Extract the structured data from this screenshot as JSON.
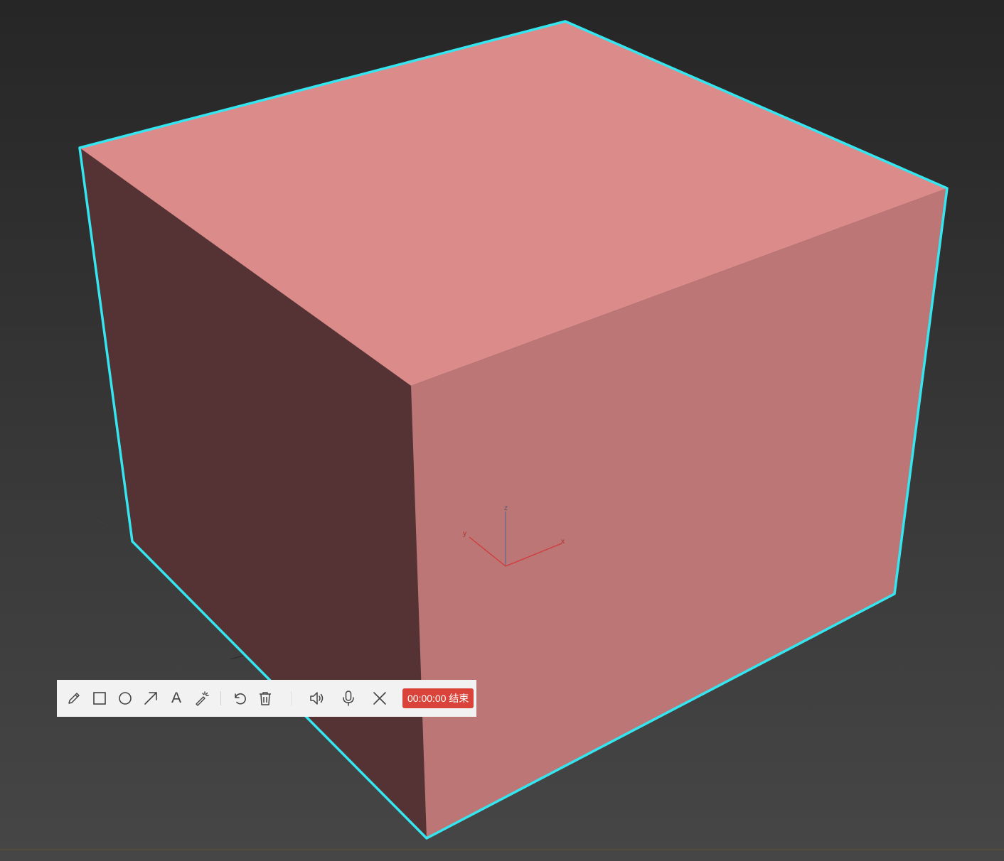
{
  "viewport": {
    "background_top": "#262626",
    "background_bottom": "#464646"
  },
  "object": {
    "top_face_color": "#db8b89",
    "right_face_color": "#bb7675",
    "left_face_color": "#553233",
    "selection_outline_color": "#35e6f0"
  },
  "axis_gizmo": {
    "x_label": "x",
    "y_label": "y",
    "z_label": "z",
    "x_color": "#d23a3a",
    "y_color": "#d23a3a",
    "z_color": "#6a6a8a"
  },
  "toolbar": {
    "tools": [
      {
        "name": "pencil-icon"
      },
      {
        "name": "rectangle-icon"
      },
      {
        "name": "circle-icon"
      },
      {
        "name": "arrow-icon"
      },
      {
        "name": "text-icon",
        "glyph": "A"
      },
      {
        "name": "magic-wand-icon"
      },
      {
        "name": "undo-icon"
      },
      {
        "name": "trash-icon"
      },
      {
        "name": "speaker-icon"
      },
      {
        "name": "microphone-icon"
      },
      {
        "name": "close-icon"
      }
    ],
    "text_tool_glyph": "A",
    "timer": "00:00:00",
    "end_label": "结束",
    "record_label": "00:00:00 结束",
    "record_color": "#d9433a"
  }
}
